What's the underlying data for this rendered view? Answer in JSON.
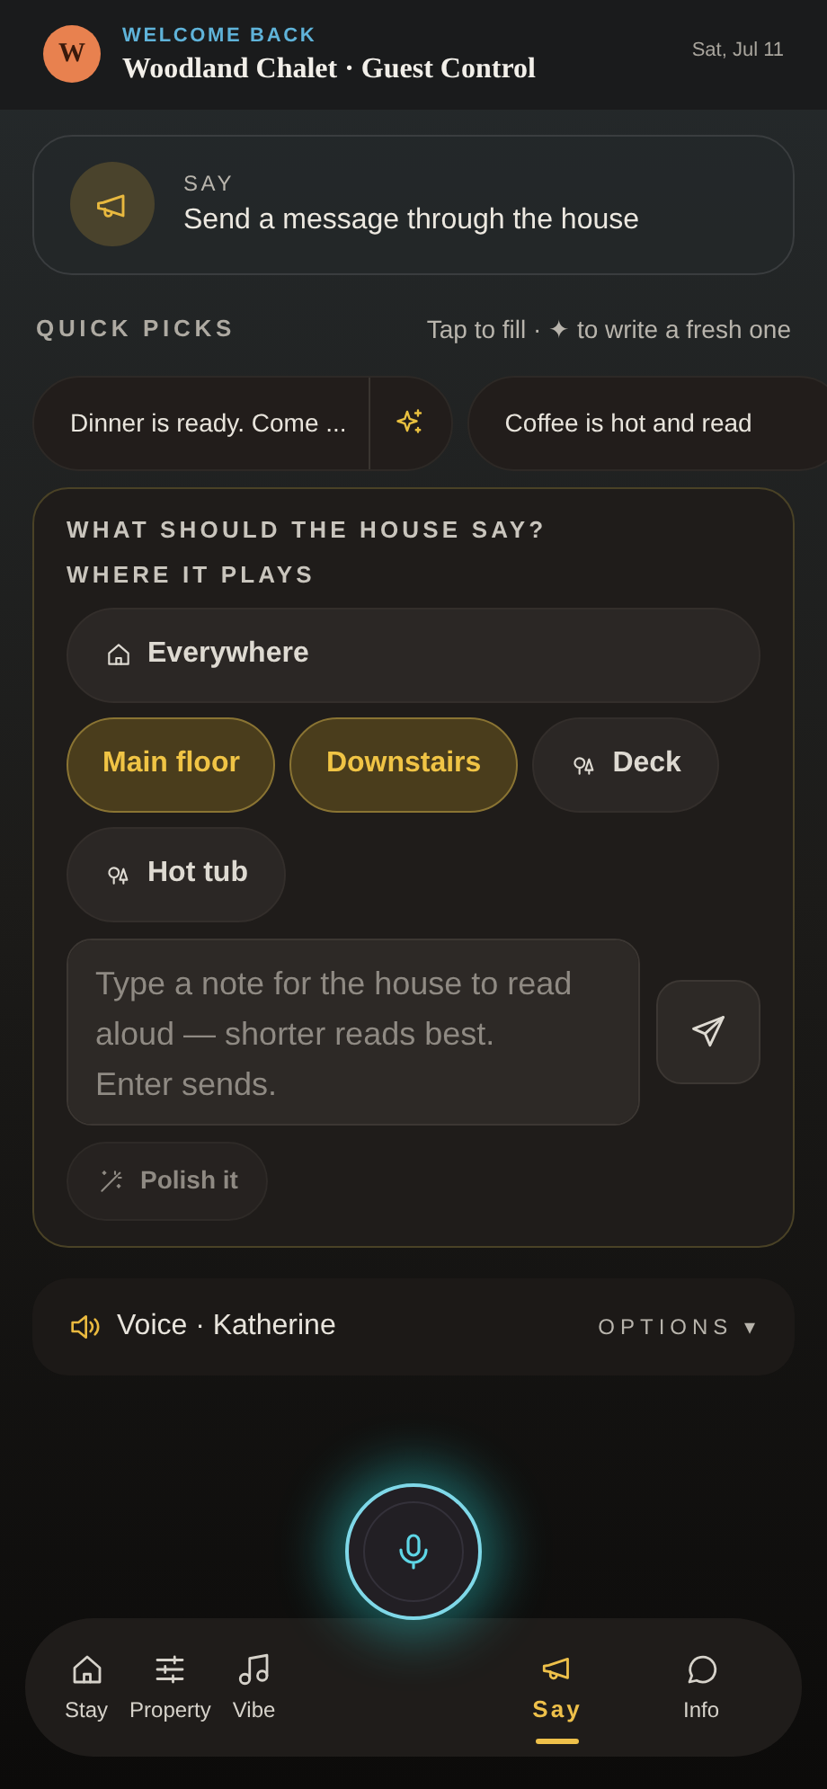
{
  "header": {
    "avatar": "W",
    "eyebrow": "WELCOME BACK",
    "title": "Woodland Chalet · Guest Control",
    "date": "Sat, Jul 11"
  },
  "banner": {
    "eyebrow": "SAY",
    "title": "Send a message through the house"
  },
  "quick_picks": {
    "label": "QUICK PICKS",
    "hint": "Tap to fill · ✦ to write a fresh one",
    "items": [
      {
        "text": "Dinner is ready. Come ..."
      },
      {
        "text": "Coffee is hot and read"
      }
    ]
  },
  "composer": {
    "heading": "WHAT SHOULD THE HOUSE SAY?",
    "zones_label": "WHERE IT PLAYS",
    "zones": [
      {
        "label": "Everywhere",
        "kind": "house",
        "selected": false
      },
      {
        "label": "Main floor",
        "kind": "plain",
        "selected": true
      },
      {
        "label": "Downstairs",
        "kind": "plain",
        "selected": true
      },
      {
        "label": "Deck",
        "kind": "outdoor",
        "selected": false
      },
      {
        "label": "Hot tub",
        "kind": "outdoor",
        "selected": false
      }
    ],
    "placeholder": "Type a note for the house to read aloud — shorter reads best. Enter sends.",
    "polish": "Polish it"
  },
  "voice": {
    "label": "Voice · Katherine",
    "options": "OPTIONS ▾"
  },
  "nav": [
    {
      "label": "Stay",
      "kind": "home",
      "selected": false
    },
    {
      "label": "Property",
      "kind": "sliders",
      "selected": false
    },
    {
      "label": "Vibe",
      "kind": "music",
      "selected": false
    },
    {
      "label": "Say",
      "kind": "megaphone",
      "selected": true
    },
    {
      "label": "Info",
      "kind": "chat",
      "selected": false
    }
  ]
}
